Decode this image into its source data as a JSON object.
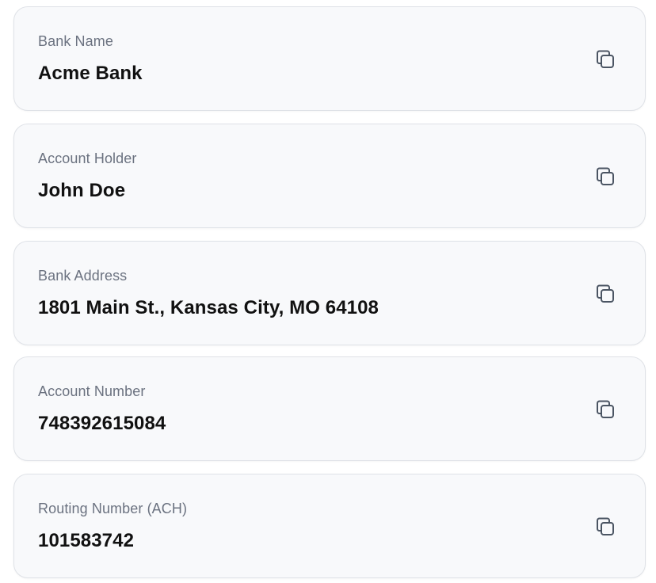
{
  "fields": [
    {
      "label": "Bank Name",
      "value": "Acme Bank",
      "icon": "copy-icon"
    },
    {
      "label": "Account Holder",
      "value": "John Doe",
      "icon": "copy-icon"
    },
    {
      "label": "Bank Address",
      "value": "1801 Main St., Kansas City, MO 64108",
      "icon": "copy-icon"
    },
    {
      "label": "Account Number",
      "value": "748392615084",
      "icon": "copy-icon"
    },
    {
      "label": "Routing Number (ACH)",
      "value": "101583742",
      "icon": "copy-icon"
    }
  ],
  "colors": {
    "card_background": "#f8f9fb",
    "card_border": "#dfe2e7",
    "label_text": "#6b7280",
    "value_text": "#111111",
    "icon_stroke": "#4b5563"
  }
}
